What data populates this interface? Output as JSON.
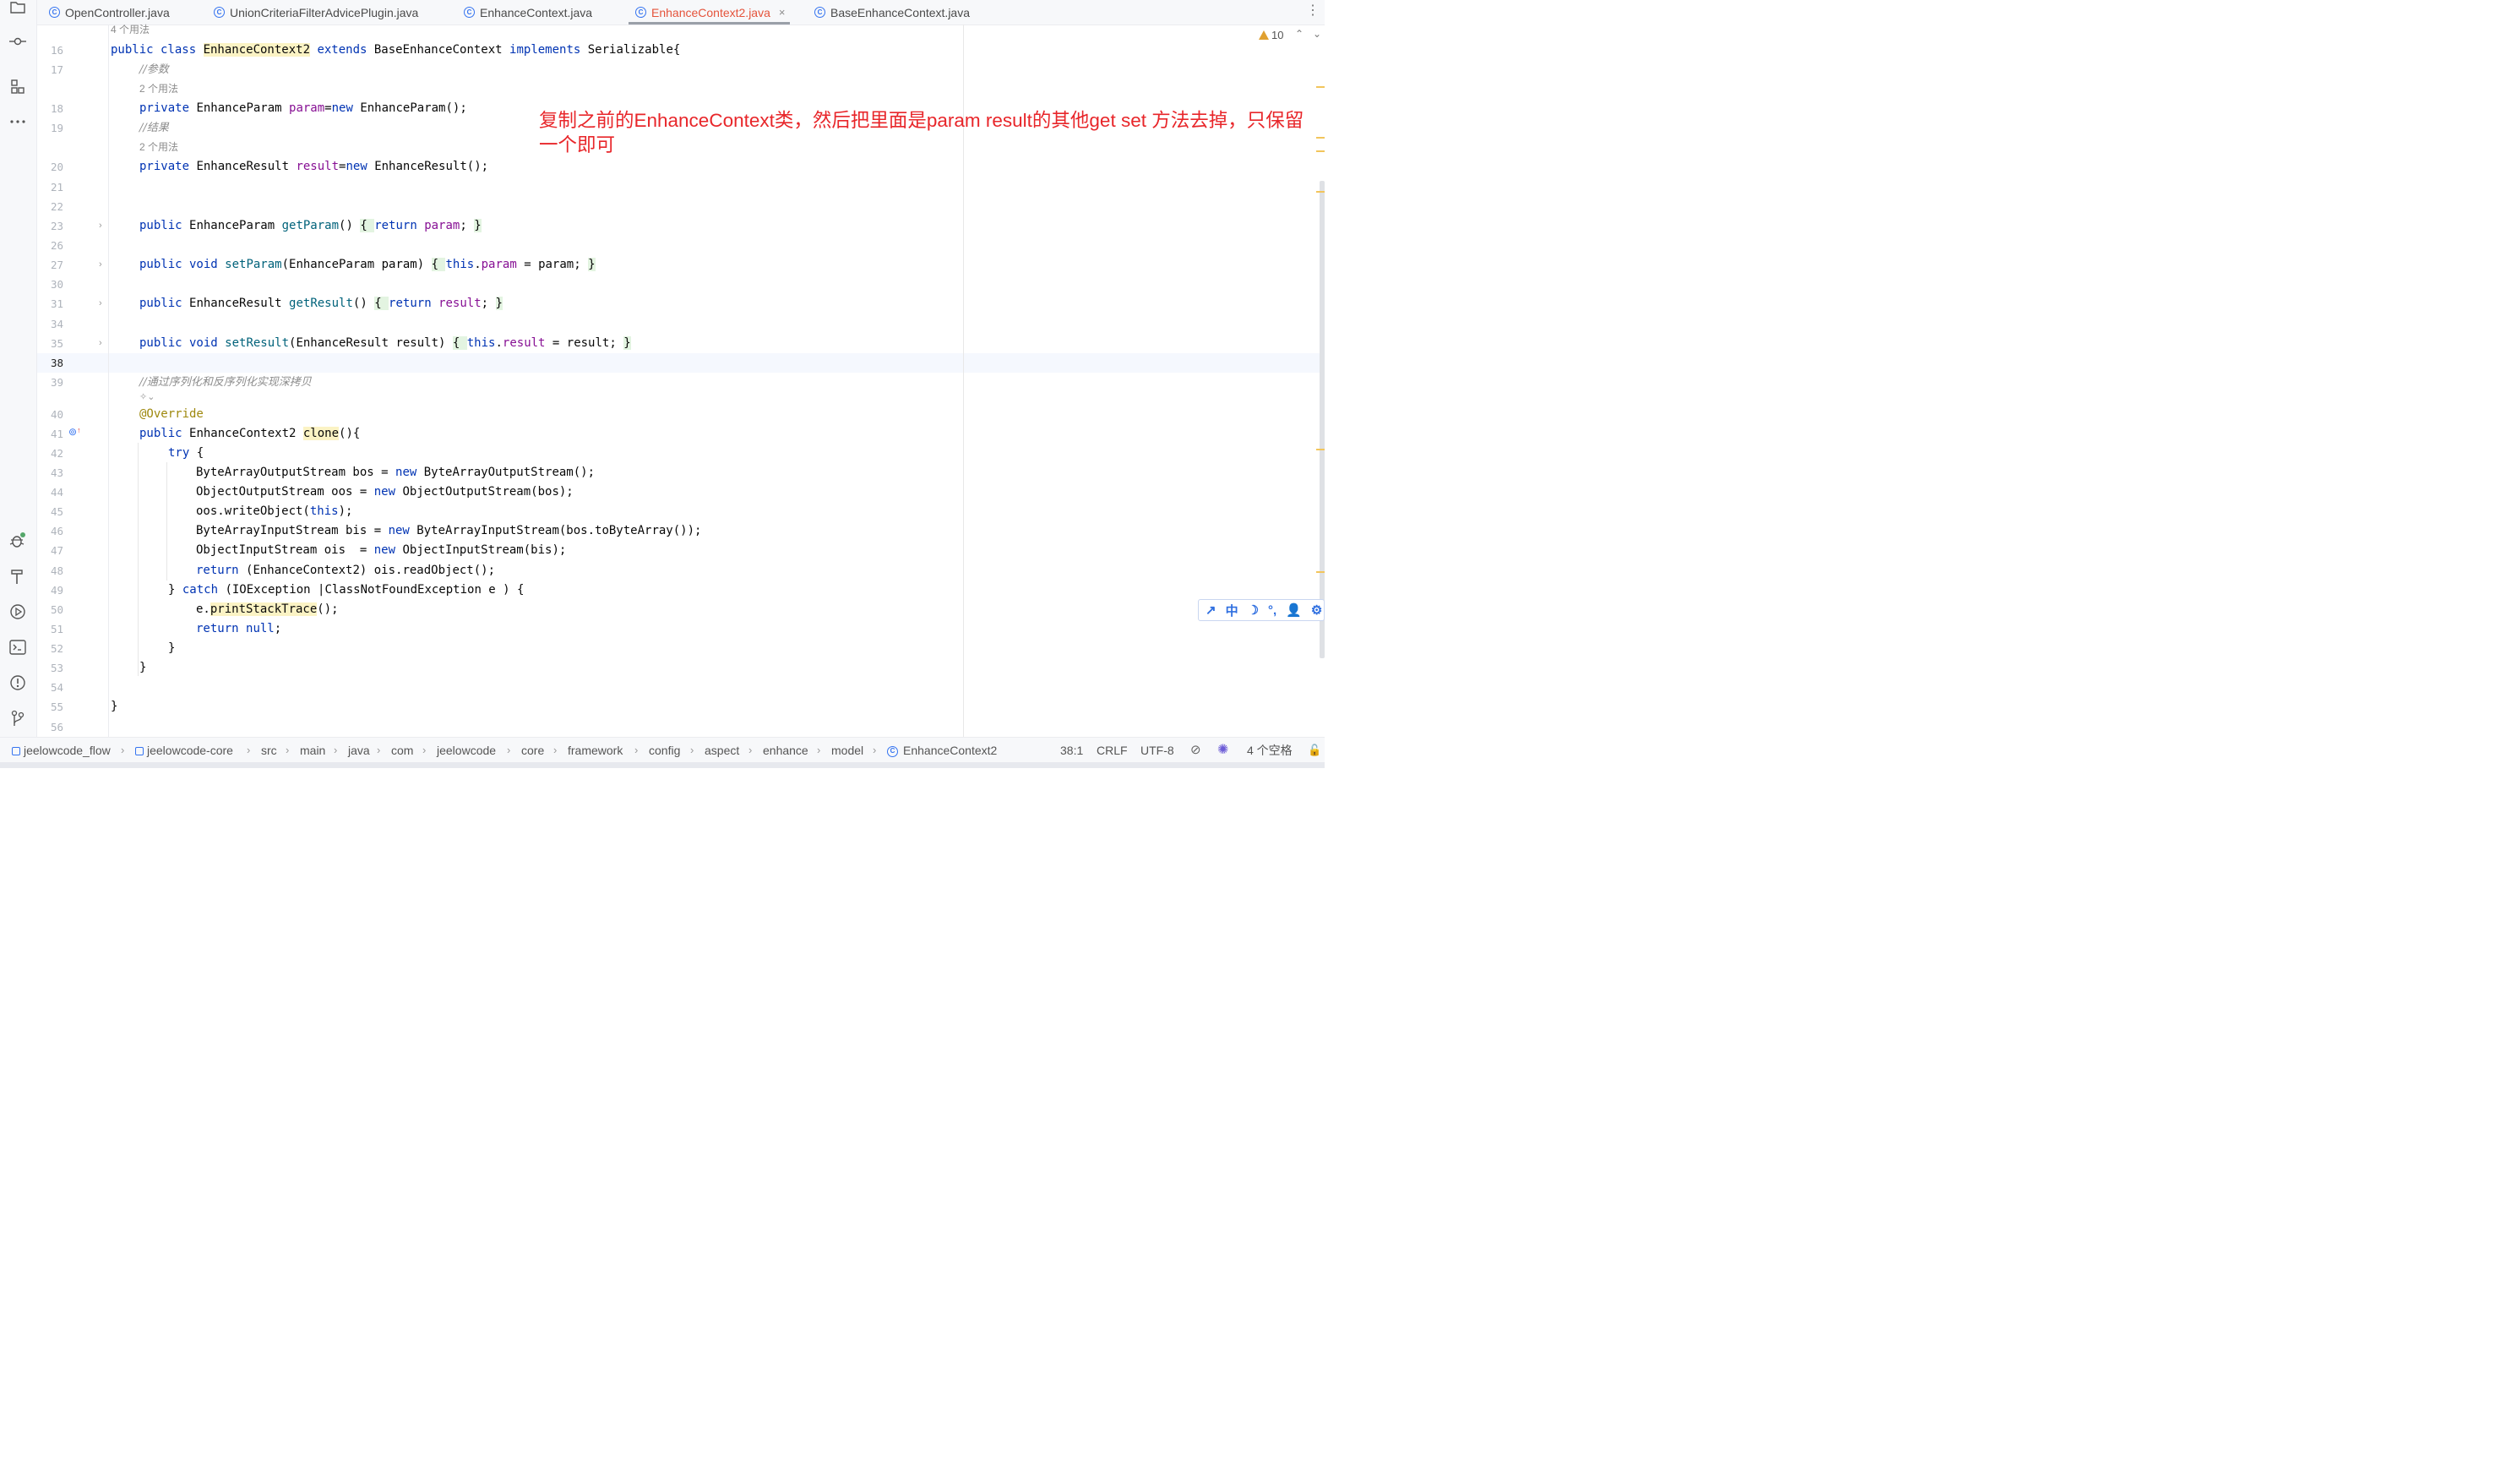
{
  "tabs": [
    {
      "label": "OpenController.java",
      "active": false
    },
    {
      "label": "UnionCriteriaFilterAdvicePlugin.java",
      "active": false
    },
    {
      "label": "EnhanceContext.java",
      "active": false
    },
    {
      "label": "EnhanceContext2.java",
      "active": true
    },
    {
      "label": "BaseEnhanceContext.java",
      "active": false
    }
  ],
  "tab_close_glyph": "×",
  "usage_hints": {
    "h4": "4 个用法",
    "h2a": "2 个用法",
    "h2b": "2 个用法"
  },
  "line_numbers": {
    "l16": "16",
    "l17": "17",
    "l18": "18",
    "l19": "19",
    "l20": "20",
    "l21": "21",
    "l22": "22",
    "l23": "23",
    "l26": "26",
    "l27": "27",
    "l30": "30",
    "l31": "31",
    "l34": "34",
    "l35": "35",
    "l38": "38",
    "l39": "39",
    "l40": "40",
    "l41": "41",
    "l42": "42",
    "l43": "43",
    "l44": "44",
    "l45": "45",
    "l46": "46",
    "l47": "47",
    "l48": "48",
    "l49": "49",
    "l50": "50",
    "l51": "51",
    "l52": "52",
    "l53": "53",
    "l54": "54",
    "l55": "55",
    "l56": "56"
  },
  "code": {
    "l16": {
      "a": "public class ",
      "b": "EnhanceContext2",
      "c": " extends ",
      "d": "BaseEnhanceContext ",
      "e": "implements ",
      "f": "Serializable{"
    },
    "l17": "//参数",
    "l18": {
      "a": "private ",
      "b": "EnhanceParam ",
      "c": "param",
      "d": "=",
      "e": "new ",
      "f": "EnhanceParam();"
    },
    "l19": "//结果",
    "l20": {
      "a": "private ",
      "b": "EnhanceResult ",
      "c": "result",
      "d": "=",
      "e": "new ",
      "f": "EnhanceResult();"
    },
    "l23": {
      "a": "public ",
      "b": "EnhanceParam ",
      "c": "getParam",
      "d": "() ",
      "e": "{ ",
      "f": "return ",
      "g": "param",
      "h": "; ",
      "i": "}"
    },
    "l27": {
      "a": "public void ",
      "b": "setParam",
      "c": "(EnhanceParam param) ",
      "d": "{ ",
      "e": "this",
      "f": ".",
      "g": "param",
      "h": " = param; ",
      "i": "}"
    },
    "l31": {
      "a": "public ",
      "b": "EnhanceResult ",
      "c": "getResult",
      "d": "() ",
      "e": "{ ",
      "f": "return ",
      "g": "result",
      "h": "; ",
      "i": "}"
    },
    "l35": {
      "a": "public void ",
      "b": "setResult",
      "c": "(EnhanceResult result) ",
      "d": "{ ",
      "e": "this",
      "f": ".",
      "g": "result",
      "h": " = result; ",
      "i": "}"
    },
    "l39": "//通过序列化和反序列化实现深拷贝",
    "l40": "@Override",
    "l41": {
      "a": "public ",
      "b": "EnhanceContext2 ",
      "c": "clone",
      "d": "(){"
    },
    "l42": {
      "a": "try ",
      "b": "{"
    },
    "l43": {
      "a": "ByteArrayOutputStream bos = ",
      "b": "new ",
      "c": "ByteArrayOutputStream();"
    },
    "l44": {
      "a": "ObjectOutputStream oos = ",
      "b": "new ",
      "c": "ObjectOutputStream(bos);"
    },
    "l45": {
      "a": "oos.writeObject(",
      "b": "this",
      "c": ");"
    },
    "l46": {
      "a": "ByteArrayInputStream bis = ",
      "b": "new ",
      "c": "ByteArrayInputStream(bos.toByteArray());"
    },
    "l47": {
      "a": "ObjectInputStream ois  = ",
      "b": "new ",
      "c": "ObjectInputStream(bis);"
    },
    "l48": {
      "a": "return ",
      "b": "(EnhanceContext2) ois.readObject();"
    },
    "l49": {
      "a": "} ",
      "b": "catch ",
      "c": "(IOException |ClassNotFoundException e ) {"
    },
    "l50": {
      "a": "e.",
      "b": "printStackTrace",
      "c": "();"
    },
    "l51": {
      "a": "return ",
      "b": "null",
      "c": ";"
    },
    "l52": "}",
    "l53": "}",
    "l55": "}"
  },
  "annotation_text": "复制之前的EnhanceContext类，然后把里面是param  result的其他get set 方法去掉，只保留一个即可",
  "warnings_count": "10",
  "status": {
    "breadcrumbs": [
      "jeelowcode_flow",
      "jeelowcode-core",
      "src",
      "main",
      "java",
      "com",
      "jeelowcode",
      "core",
      "framework",
      "config",
      "aspect",
      "enhance",
      "model",
      "EnhanceContext2"
    ],
    "position": "38:1",
    "line_ending": "CRLF",
    "encoding": "UTF-8",
    "indent": "4 个空格"
  },
  "ime": {
    "lang": "中"
  },
  "colors": {
    "keyword": "#0033b3",
    "field": "#871094",
    "method": "#00627a",
    "annotation": "#9e880d",
    "comment": "#8c8c8c",
    "annotation_text": "#e8262a",
    "active_tab": "#e5533b"
  }
}
